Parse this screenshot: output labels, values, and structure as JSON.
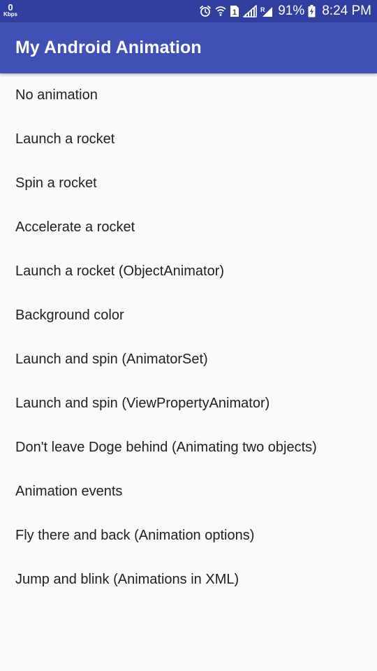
{
  "status_bar": {
    "network_speed_value": "0",
    "network_speed_unit": "Kbps",
    "battery_percent": "91%",
    "time": "8:24 PM",
    "icons": [
      "alarm-icon",
      "wifi-icon",
      "sim-1-icon",
      "signal-icon",
      "signal-r-icon",
      "battery-charging-icon"
    ]
  },
  "app_bar": {
    "title": "My Android Animation"
  },
  "menu": {
    "items": [
      {
        "label": "No animation"
      },
      {
        "label": "Launch a rocket"
      },
      {
        "label": "Spin a rocket"
      },
      {
        "label": "Accelerate a rocket"
      },
      {
        "label": "Launch a rocket (ObjectAnimator)"
      },
      {
        "label": "Background color"
      },
      {
        "label": "Launch and spin (AnimatorSet)"
      },
      {
        "label": "Launch and spin (ViewPropertyAnimator)"
      },
      {
        "label": "Don't leave Doge behind (Animating two objects)"
      },
      {
        "label": "Animation events"
      },
      {
        "label": "Fly there and back (Animation options)"
      },
      {
        "label": "Jump and blink (Animations in XML)"
      }
    ]
  },
  "colors": {
    "status_bar": "#303f9f",
    "app_bar": "#3f51b5",
    "background": "#fafafa",
    "text_primary": "#212121"
  }
}
